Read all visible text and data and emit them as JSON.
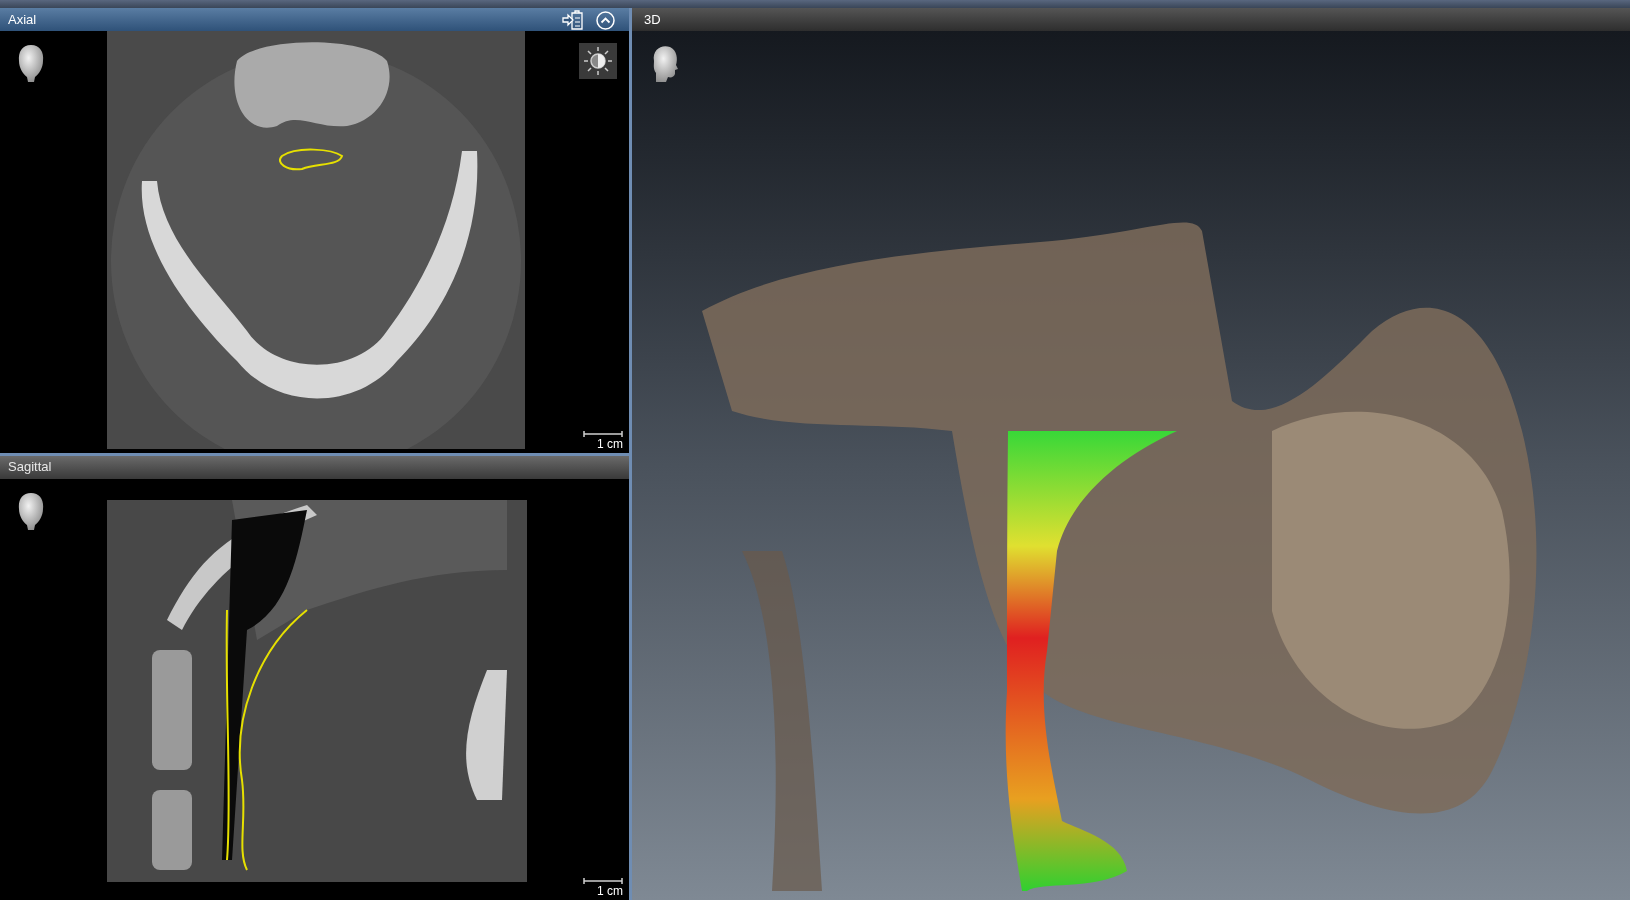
{
  "slice_views": [
    {
      "title": "Axial",
      "selected": true,
      "scale_label": "1 cm",
      "kind": "axial"
    },
    {
      "title": "Sagittal",
      "selected": false,
      "scale_label": "1 cm",
      "kind": "sagittal"
    }
  ],
  "volume_view": {
    "title": "3D",
    "selected": false
  }
}
